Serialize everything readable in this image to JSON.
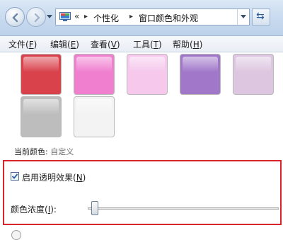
{
  "address": {
    "overflow": "«",
    "crumbs": [
      "个性化",
      "窗口颜色和外观"
    ],
    "separator": "▸",
    "refresh_icon": "refresh-icon"
  },
  "menu": [
    {
      "label": "文件(",
      "key": "F",
      "end": ")"
    },
    {
      "label": "编辑(",
      "key": "E",
      "end": ")"
    },
    {
      "label": "查看(",
      "key": "V",
      "end": ")"
    },
    {
      "label": "工具(",
      "key": "T",
      "end": ")"
    },
    {
      "label": "帮助(",
      "key": "H",
      "end": ")"
    }
  ],
  "swatches": [
    {
      "name": "red",
      "color": "#d9414b"
    },
    {
      "name": "pink",
      "color": "#f07fd0"
    },
    {
      "name": "light-pink",
      "color": "#f5c8ec"
    },
    {
      "name": "purple",
      "color": "#a077c9"
    },
    {
      "name": "lavender",
      "color": "#ddc6e0"
    },
    {
      "name": "gray",
      "color": "#bdbdbd"
    },
    {
      "name": "white",
      "color": "#f3f3f3"
    }
  ],
  "current_color": {
    "label": "当前颜色:",
    "value": "自定义"
  },
  "transparency": {
    "label": "启用透明效果(",
    "key": "N",
    "end": ")",
    "checked": true
  },
  "intensity": {
    "label": "颜色浓度(",
    "key": "I",
    "end": "):",
    "value_fraction": 0.02
  },
  "colors": {
    "highlight_border": "#d9242c",
    "checkbox_tick": "#2f5f9e"
  }
}
